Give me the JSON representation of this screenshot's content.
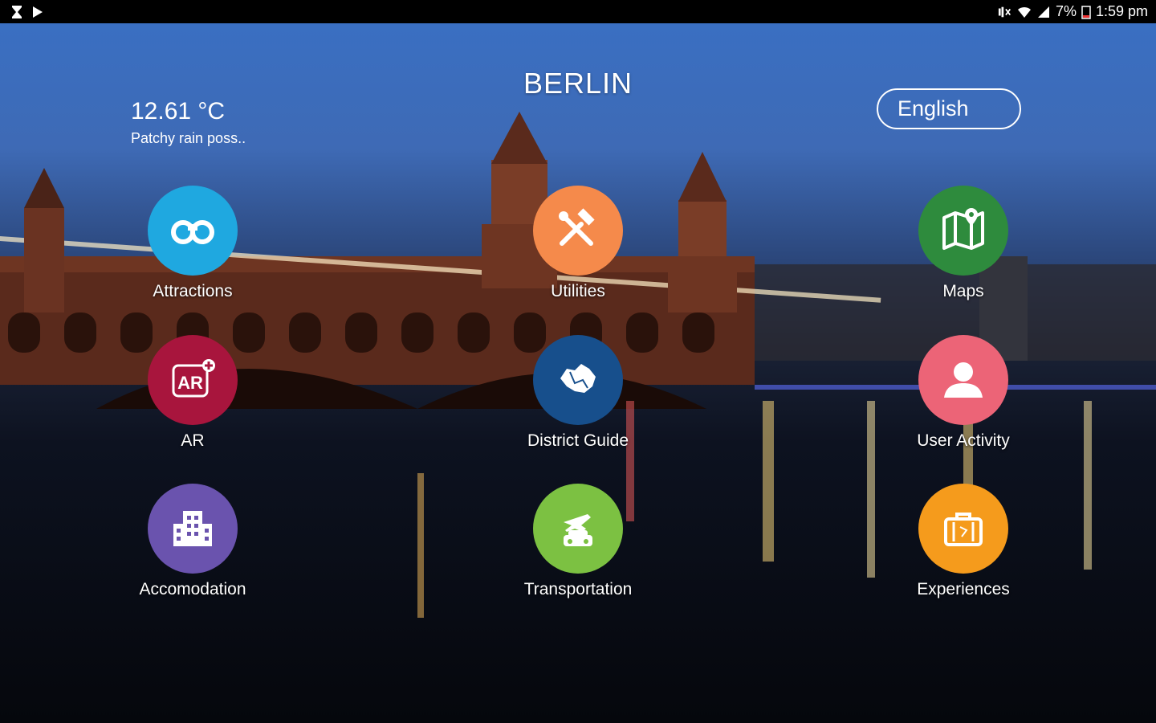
{
  "status_bar": {
    "battery": "7%",
    "time": "1:59 pm",
    "left_icons": [
      "hourglass-icon",
      "play-store-icon"
    ],
    "right_icons": [
      "mute-icon",
      "wifi-icon",
      "signal-icon",
      "battery-icon"
    ]
  },
  "header": {
    "city": "BERLIN",
    "temperature": "12.61 °C",
    "condition": "Patchy rain poss..",
    "language": "English"
  },
  "menu": [
    {
      "label": "Attractions",
      "icon": "binoculars-icon",
      "color": "#1fa8e0"
    },
    {
      "label": "Utilities",
      "icon": "tools-icon",
      "color": "#f58a4b"
    },
    {
      "label": "Maps",
      "icon": "map-pin-icon",
      "color": "#2e8b3d"
    },
    {
      "label": "AR",
      "icon": "ar-icon",
      "color": "#a8153d"
    },
    {
      "label": "District Guide",
      "icon": "district-map-icon",
      "color": "#174f8c"
    },
    {
      "label": "User Activity",
      "icon": "user-icon",
      "color": "#ec6477"
    },
    {
      "label": "Accomodation",
      "icon": "building-icon",
      "color": "#6a53ae"
    },
    {
      "label": "Transportation",
      "icon": "plane-car-icon",
      "color": "#7cc142"
    },
    {
      "label": "Experiences",
      "icon": "suitcase-icon",
      "color": "#f59b1c"
    }
  ]
}
